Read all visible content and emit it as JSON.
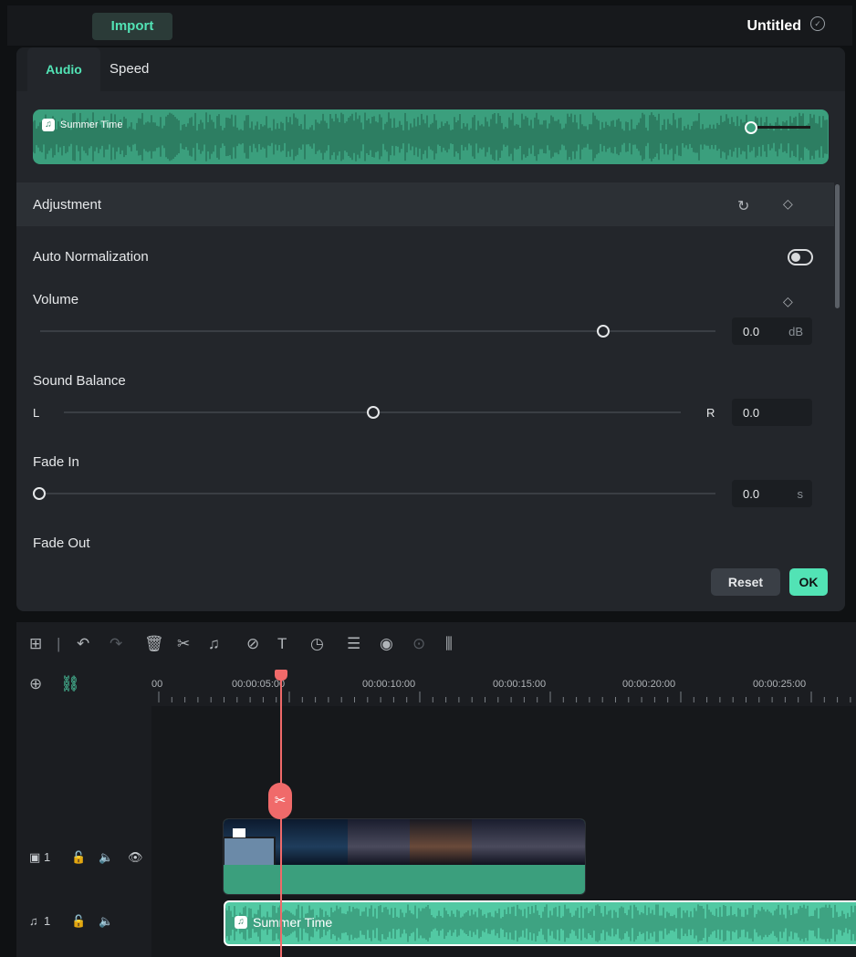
{
  "topbar": {
    "import_label": "Import",
    "project_title": "Untitled"
  },
  "tabs": [
    {
      "label": "Audio"
    },
    {
      "label": "Speed"
    }
  ],
  "clip_preview": {
    "name": "Summer Time"
  },
  "adjustment": {
    "title": "Adjustment",
    "auto_normalization": {
      "label": "Auto Normalization",
      "enabled": false
    },
    "volume": {
      "label": "Volume",
      "value": "0.0",
      "unit": "dB"
    },
    "sound_balance": {
      "label": "Sound Balance",
      "left": "L",
      "right": "R",
      "value": "0.0"
    },
    "fade_in": {
      "label": "Fade In",
      "value": "0.0",
      "unit": "s"
    },
    "fade_out": {
      "label": "Fade Out"
    }
  },
  "buttons": {
    "reset": "Reset",
    "ok": "OK"
  },
  "timeline": {
    "ruler_labels": [
      "00",
      "00:00:05:00",
      "00:00:10:00",
      "00:00:15:00",
      "00:00:20:00",
      "00:00:25:00"
    ],
    "video_track": {
      "number": "1"
    },
    "audio_track": {
      "number": "1",
      "clip_name": "Summer Time"
    }
  },
  "colors": {
    "accent": "#52e3b5",
    "clip_green": "#3b9f7d",
    "playhead": "#f06a6a"
  }
}
